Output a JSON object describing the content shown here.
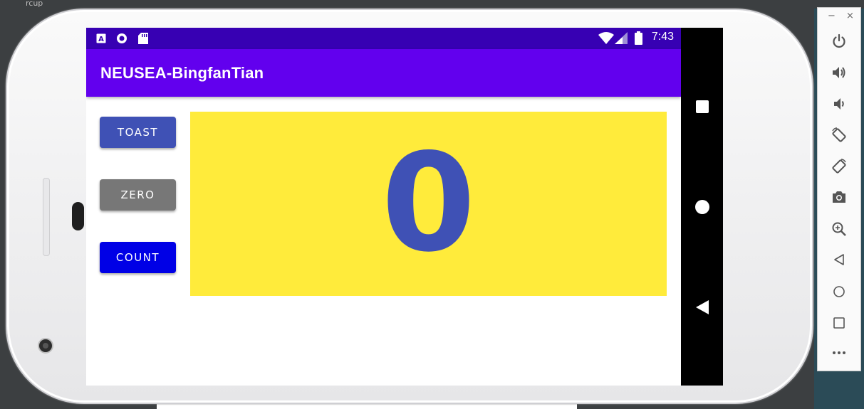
{
  "status_bar": {
    "time": "7:43"
  },
  "app_bar": {
    "title": "NEUSEA-BingfanTian"
  },
  "buttons": {
    "toast": "TOAST",
    "zero": "ZERO",
    "count": "COUNT"
  },
  "counter": {
    "value": "0"
  },
  "colors": {
    "status_bar": "#3700b3",
    "app_bar": "#6200ee",
    "toast_button": "#3f51b5",
    "zero_button": "#777777",
    "count_button": "#0000e6",
    "counter_background": "#ffeb3b",
    "counter_text": "#3f51b5"
  },
  "emulator_toolbar": {
    "window_controls": [
      "−",
      "×"
    ],
    "icons": [
      "power-icon",
      "volume-up-icon",
      "volume-down-icon",
      "rotate-left-icon",
      "rotate-right-icon",
      "camera-icon",
      "zoom-icon",
      "back-icon",
      "home-icon",
      "overview-icon",
      "more-icon"
    ]
  },
  "ide": {
    "fragment_text": "rcup"
  }
}
